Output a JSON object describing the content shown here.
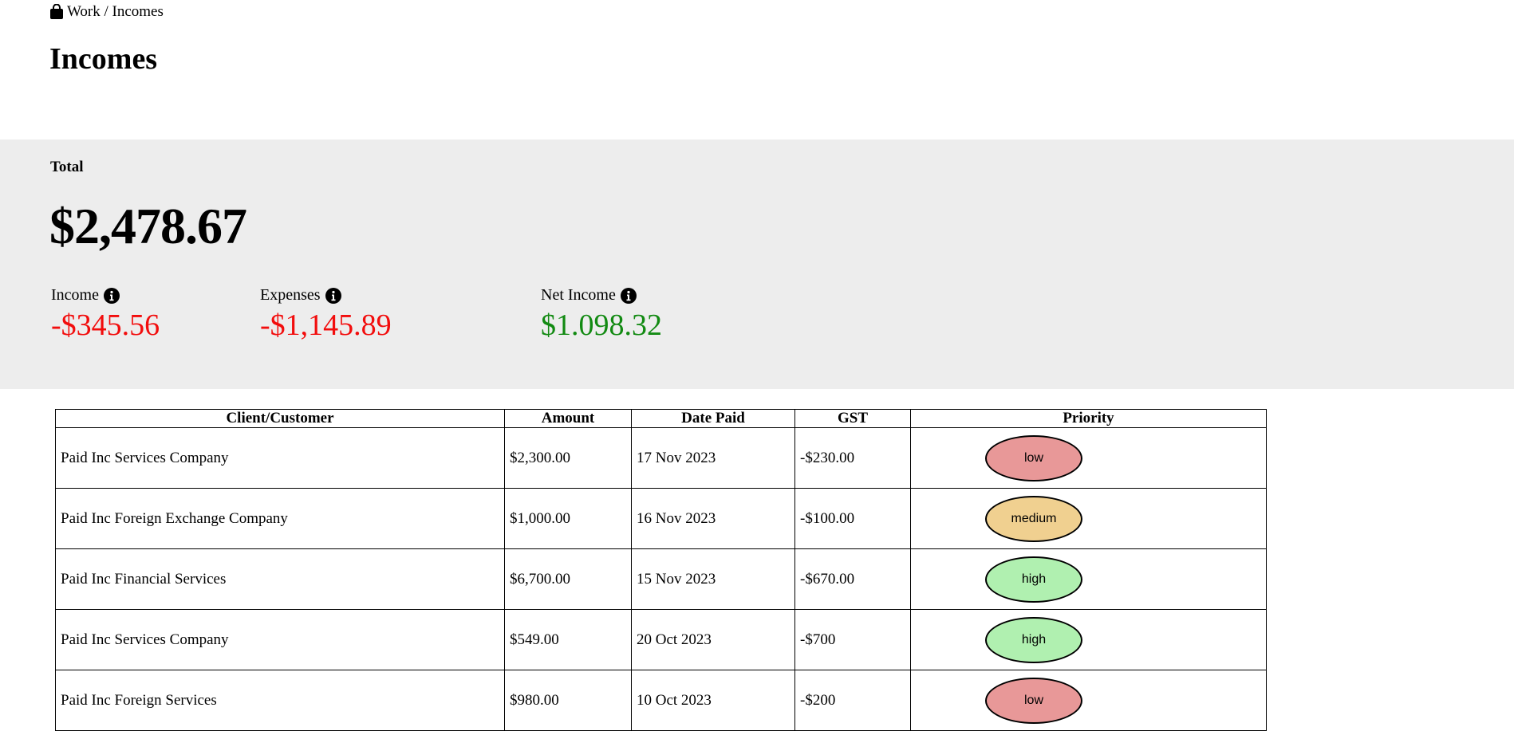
{
  "breadcrumb": {
    "icon": "shopping-bag-icon",
    "path": "Work / Incomes"
  },
  "page": {
    "title": "Incomes"
  },
  "summary": {
    "total_label": "Total",
    "total_value": "$2,478.67",
    "income": {
      "label": "Income",
      "value": "-$345.56",
      "icon": "info-icon"
    },
    "expenses": {
      "label": "Expenses",
      "value": "-$1,145.89",
      "icon": "info-icon"
    },
    "net_income": {
      "label": "Net Income",
      "value": "$1.098.32",
      "icon": "info-icon"
    },
    "colors": {
      "negative": "#f20d0d",
      "positive": "#128a12",
      "panel_bg": "#ededed"
    }
  },
  "table": {
    "headers": [
      "Client/Customer",
      "Amount",
      "Date Paid",
      "GST",
      "Priority"
    ],
    "rows": [
      {
        "client": "Paid Inc Services Company",
        "amount": "$2,300.00",
        "date": "17 Nov 2023",
        "gst": "-$230.00",
        "priority": "low"
      },
      {
        "client": "Paid Inc Foreign Exchange Company",
        "amount": "$1,000.00",
        "date": "16 Nov 2023",
        "gst": "-$100.00",
        "priority": "medium"
      },
      {
        "client": "Paid Inc Financial Services",
        "amount": "$6,700.00",
        "date": "15 Nov 2023",
        "gst": "-$670.00",
        "priority": "high"
      },
      {
        "client": "Paid Inc Services Company",
        "amount": "$549.00",
        "date": "20 Oct 2023",
        "gst": "-$700",
        "priority": "high"
      },
      {
        "client": "Paid Inc Foreign Services",
        "amount": "$980.00",
        "date": "10 Oct 2023",
        "gst": "-$200",
        "priority": "low"
      }
    ],
    "priority_colors": {
      "low": "#e89898",
      "medium": "#f0d090",
      "high": "#b0f0b0"
    }
  }
}
